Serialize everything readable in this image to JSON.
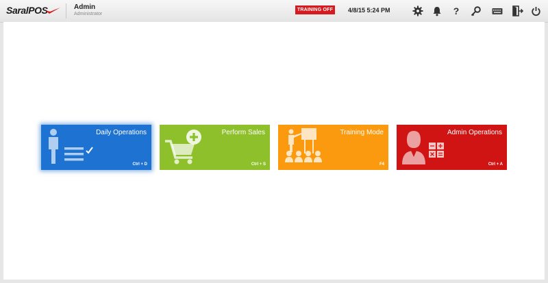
{
  "app": {
    "logo_text": "SaralPOS"
  },
  "user": {
    "name": "Admin",
    "role": "Administrator"
  },
  "header": {
    "training_label": "TRAINING OFF",
    "datetime": "4/8/15 5:24 PM",
    "icons": [
      "gear-icon",
      "bell-icon",
      "help-icon",
      "key-icon",
      "keyboard-icon",
      "logout-icon",
      "power-icon"
    ]
  },
  "tiles": [
    {
      "title": "Daily Operations",
      "shortcut": "Ctrl + D",
      "color": "#1e72d2"
    },
    {
      "title": "Perform Sales",
      "shortcut": "Ctrl + S",
      "color": "#8dc02b"
    },
    {
      "title": "Training Mode",
      "shortcut": "F4",
      "color": "#fb9a0e"
    },
    {
      "title": "Admin Operations",
      "shortcut": "Ctrl + A",
      "color": "#d01414"
    }
  ],
  "colors": {
    "training_badge": "#d71920",
    "header_bg": "#eeeeee"
  }
}
